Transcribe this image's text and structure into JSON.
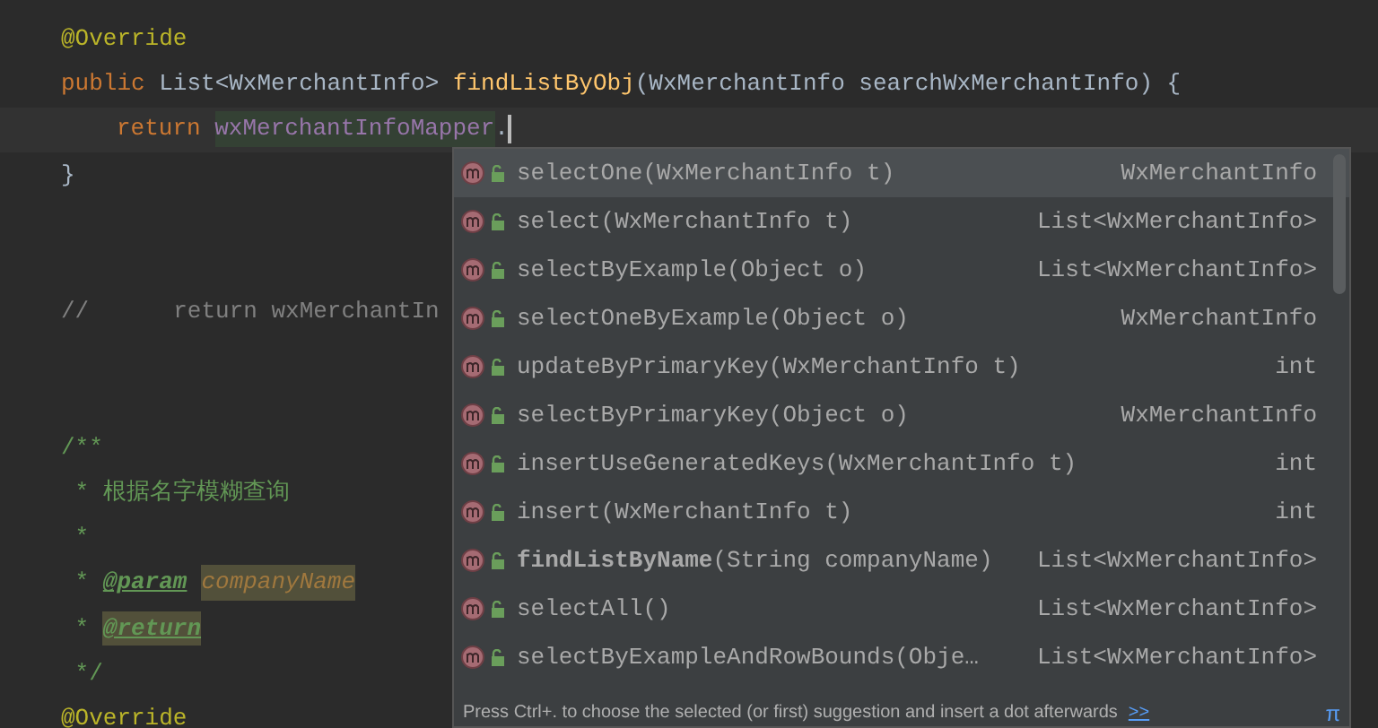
{
  "editor": {
    "lines": [
      {
        "kind": "code",
        "tokens": [
          {
            "kind": "annotation",
            "text": "@Override"
          }
        ]
      },
      {
        "kind": "code",
        "tokens": [
          {
            "kind": "keyword",
            "text": "public "
          },
          {
            "kind": "plain",
            "text": "List<WxMerchantInfo> "
          },
          {
            "kind": "method",
            "text": "findListByObj"
          },
          {
            "kind": "plain",
            "text": "(WxMerchantInfo searchWxMerchantInfo) {"
          }
        ]
      },
      {
        "kind": "body",
        "current": true,
        "tokens": [
          {
            "kind": "keyword",
            "text": "return "
          },
          {
            "kind": "field",
            "text": "wxMerchantInfoMapper"
          },
          {
            "kind": "plain",
            "text": "."
          }
        ]
      },
      {
        "kind": "code",
        "tokens": [
          {
            "kind": "plain",
            "text": "}"
          }
        ]
      },
      {
        "kind": "blank"
      },
      {
        "kind": "blank"
      },
      {
        "kind": "code",
        "tokens": [
          {
            "kind": "comment",
            "text": "//"
          },
          {
            "kind": "commented-code",
            "text": "return wxMerchantIn"
          }
        ]
      },
      {
        "kind": "blank"
      },
      {
        "kind": "blank"
      },
      {
        "kind": "code",
        "tokens": [
          {
            "kind": "doc",
            "text": "/**"
          }
        ]
      },
      {
        "kind": "code",
        "tokens": [
          {
            "kind": "doc",
            "text": " * 根据名字模糊查询"
          }
        ]
      },
      {
        "kind": "code",
        "tokens": [
          {
            "kind": "doc",
            "text": " *"
          }
        ]
      },
      {
        "kind": "code",
        "tokens": [
          {
            "kind": "doc",
            "text": " * "
          },
          {
            "kind": "doc-tag",
            "text": "@param"
          },
          {
            "kind": "param-name",
            "text": "companyName"
          }
        ]
      },
      {
        "kind": "code",
        "tokens": [
          {
            "kind": "doc",
            "text": " * "
          },
          {
            "kind": "doc-tag-marked",
            "text": "@return"
          }
        ]
      },
      {
        "kind": "code",
        "tokens": [
          {
            "kind": "doc",
            "text": " */"
          }
        ]
      },
      {
        "kind": "code",
        "tokens": [
          {
            "kind": "annotation",
            "text": "@Override"
          }
        ]
      }
    ]
  },
  "completion": {
    "items": [
      {
        "label": "selectOne(WxMerchantInfo t)",
        "type": "WxMerchantInfo",
        "selected": true
      },
      {
        "label": "select(WxMerchantInfo t)",
        "type": "List<WxMerchantInfo>",
        "selected": false
      },
      {
        "label": "selectByExample(Object o)",
        "type": "List<WxMerchantInfo>",
        "selected": false
      },
      {
        "label": "selectOneByExample(Object o)",
        "type": "WxMerchantInfo",
        "selected": false
      },
      {
        "label": "updateByPrimaryKey(WxMerchantInfo t)",
        "type": "int",
        "selected": false
      },
      {
        "label": "selectByPrimaryKey(Object o)",
        "type": "WxMerchantInfo",
        "selected": false
      },
      {
        "label": "insertUseGeneratedKeys(WxMerchantInfo t)",
        "type": "int",
        "selected": false
      },
      {
        "label": "insert(WxMerchantInfo t)",
        "type": "int",
        "selected": false
      },
      {
        "label": "**findListByName**(String companyName)",
        "type": "List<WxMerchantInfo>",
        "selected": false
      },
      {
        "label": "selectAll()",
        "type": "List<WxMerchantInfo>",
        "selected": false
      },
      {
        "label": "selectByExampleAndRowBounds(Obje…",
        "type": "List<WxMerchantInfo>",
        "selected": false
      }
    ],
    "hint": "Press Ctrl+. to choose the selected (or first) suggestion and insert a dot afterwards",
    "hint_link": ">>",
    "corner": "π"
  }
}
